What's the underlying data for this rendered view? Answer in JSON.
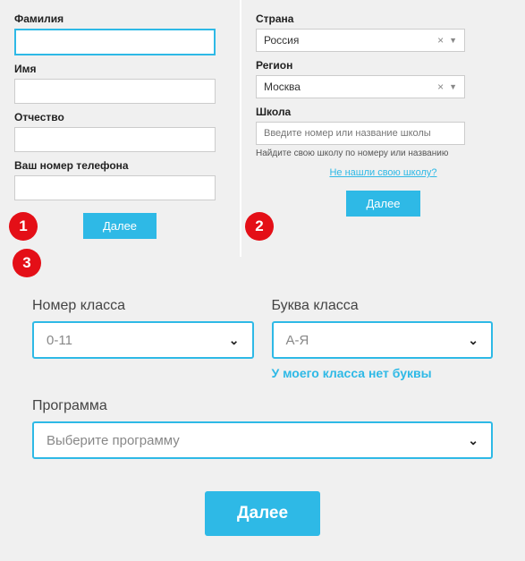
{
  "badges": {
    "one": "1",
    "two": "2",
    "three": "3"
  },
  "panel1": {
    "surname_label": "Фамилия",
    "name_label": "Имя",
    "patronymic_label": "Отчество",
    "phone_label": "Ваш номер телефона",
    "next_btn": "Далее"
  },
  "panel2": {
    "country_label": "Страна",
    "country_value": "Россия",
    "region_label": "Регион",
    "region_value": "Москва",
    "school_label": "Школа",
    "school_placeholder": "Введите номер или название школы",
    "school_hint": "Найдите свою школу по номеру или названию",
    "not_found_link": "Не нашли свою школу?",
    "next_btn": "Далее"
  },
  "panel3": {
    "class_number_label": "Номер класса",
    "class_number_value": "0-11",
    "class_letter_label": "Буква класса",
    "class_letter_value": "А-Я",
    "no_letter_link": "У моего класса нет буквы",
    "program_label": "Программа",
    "program_value": "Выберите программу",
    "next_btn": "Далее"
  }
}
